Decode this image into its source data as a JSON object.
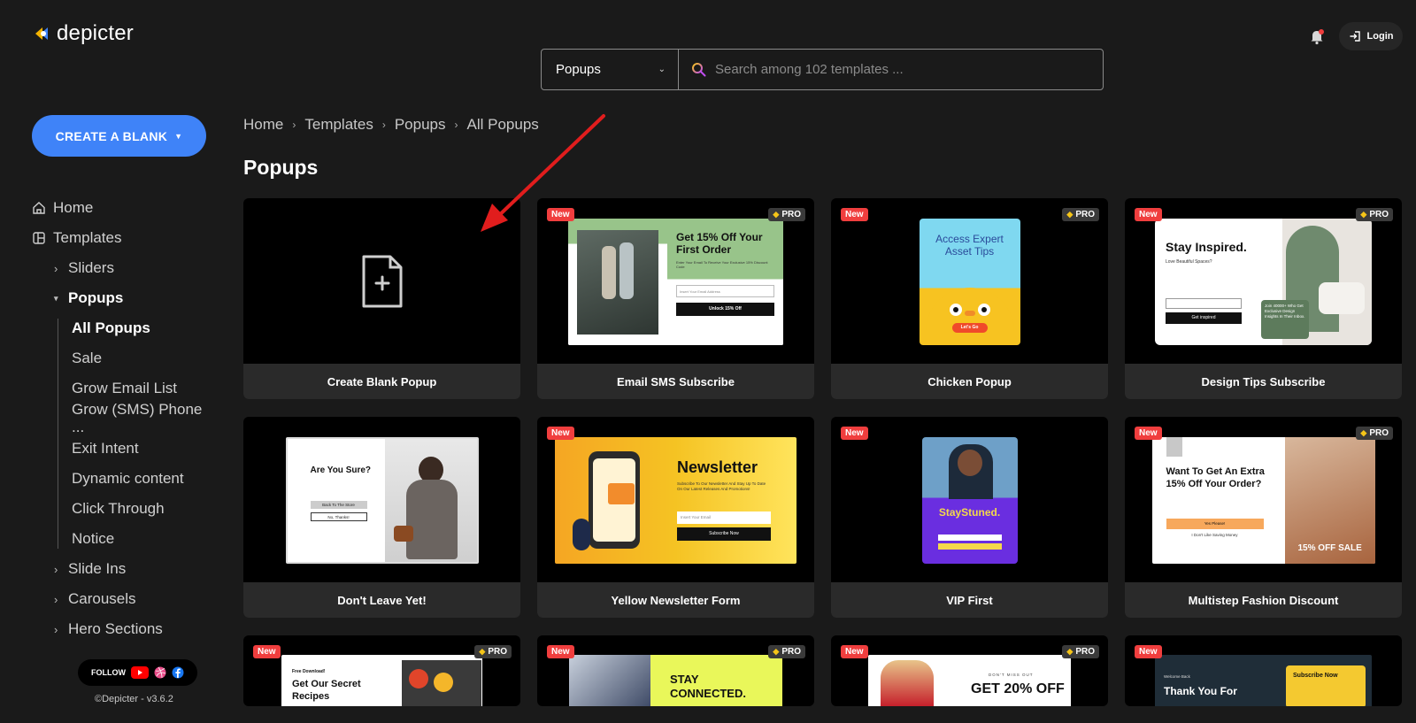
{
  "brand": {
    "name": "depicter"
  },
  "header": {
    "category_select": "Popups",
    "search_placeholder": "Search among 102 templates ...",
    "login_label": "Login"
  },
  "sidebar": {
    "create_label": "CREATE A BLANK",
    "items": [
      {
        "label": "Home",
        "icon": "home-icon"
      },
      {
        "label": "Templates",
        "icon": "layout-icon"
      }
    ],
    "template_groups": {
      "sliders": "Sliders",
      "popups": "Popups",
      "popup_children": [
        "All Popups",
        "Sale",
        "Grow Email List",
        "Grow (SMS) Phone ...",
        "Exit Intent",
        "Dynamic content",
        "Click Through",
        "Notice"
      ],
      "slide_ins": "Slide Ins",
      "carousels": "Carousels",
      "hero_sections": "Hero Sections"
    },
    "follow_label": "FOLLOW",
    "copyright": "©Depicter - v3.6.2"
  },
  "breadcrumb": [
    "Home",
    "Templates",
    "Popups",
    "All Popups"
  ],
  "page_title": "Popups",
  "badges": {
    "new": "New",
    "pro": "PRO"
  },
  "cards": [
    {
      "title": "Create Blank Popup"
    },
    {
      "title": "Email SMS Subscribe",
      "preview": {
        "heading": "Get 15% Off Your First Order",
        "sub": "Enter Your Email To Receive Your Exclusive 15% Discount Code",
        "input": "Insert Your Email Address",
        "button": "Unlock 15% Off"
      }
    },
    {
      "title": "Chicken Popup",
      "preview": {
        "heading": "Access Expert Asset Tips",
        "button": "Let's Go"
      }
    },
    {
      "title": "Design Tips Subscribe",
      "preview": {
        "heading": "Stay Inspired.",
        "sub": "Love Beautiful Spaces?",
        "button": "Get inspired",
        "stat": "Join 40000+ Who Get Exclusive Design Insights In Their Inbox."
      }
    },
    {
      "title": "Don't Leave Yet!",
      "preview": {
        "heading": "Are You Sure?",
        "button": "Back To The Store",
        "secondary": "No, Thanks!"
      }
    },
    {
      "title": "Yellow Newsletter Form",
      "preview": {
        "heading": "Newsletter",
        "sub": "Subscribe To Our Newsletter And Stay Up To Date On Our Latest Releases And Promotions!",
        "input": "Insert Your Email",
        "button": "Subscribe Now"
      }
    },
    {
      "title": "VIP First",
      "preview": {
        "heading": "StayStuned."
      }
    },
    {
      "title": "Multistep Fashion Discount",
      "preview": {
        "heading": "Want To Get An Extra 15% Off Your Order?",
        "button": "Yes Please!",
        "secondary": "I Don't Like Saving Money",
        "sale": "15% OFF SALE"
      }
    },
    {
      "title": "",
      "preview": {
        "kicker": "Free Download!",
        "heading": "Get Our Secret Recipes"
      }
    },
    {
      "title": "",
      "preview": {
        "heading": "STAY CONNECTED."
      }
    },
    {
      "title": "",
      "preview": {
        "kicker": "DON'T MISS OUT",
        "heading": "GET 20% OFF"
      }
    },
    {
      "title": "",
      "preview": {
        "kicker": "Welcome Back",
        "heading": "Thank You For",
        "button": "Subscribe Now"
      }
    }
  ],
  "colors": {
    "accent": "#3f83f8",
    "new_badge": "#f03e3e",
    "background": "#1a1a1a"
  }
}
